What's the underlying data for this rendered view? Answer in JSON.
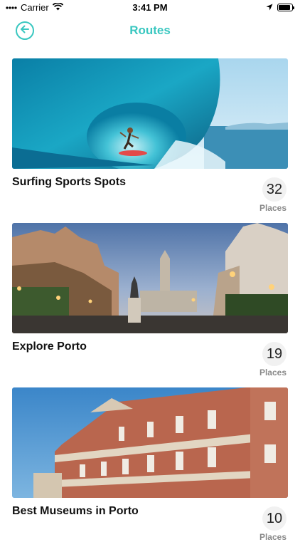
{
  "status_bar": {
    "carrier": "Carrier",
    "time": "3:41 PM",
    "battery_level": 0.9
  },
  "nav": {
    "title": "Routes",
    "back_icon": "arrow-left-circle-icon",
    "accent_color": "#39c7c0"
  },
  "routes": [
    {
      "name": "Surfing Sports Spots",
      "count": "32",
      "count_label": "Places",
      "image": "surfer-wave-photo"
    },
    {
      "name": "Explore Porto",
      "count": "19",
      "count_label": "Places",
      "image": "porto-avenue-photo"
    },
    {
      "name": "Best Museums in Porto",
      "count": "10",
      "count_label": "Places",
      "image": "museum-building-photo"
    }
  ]
}
